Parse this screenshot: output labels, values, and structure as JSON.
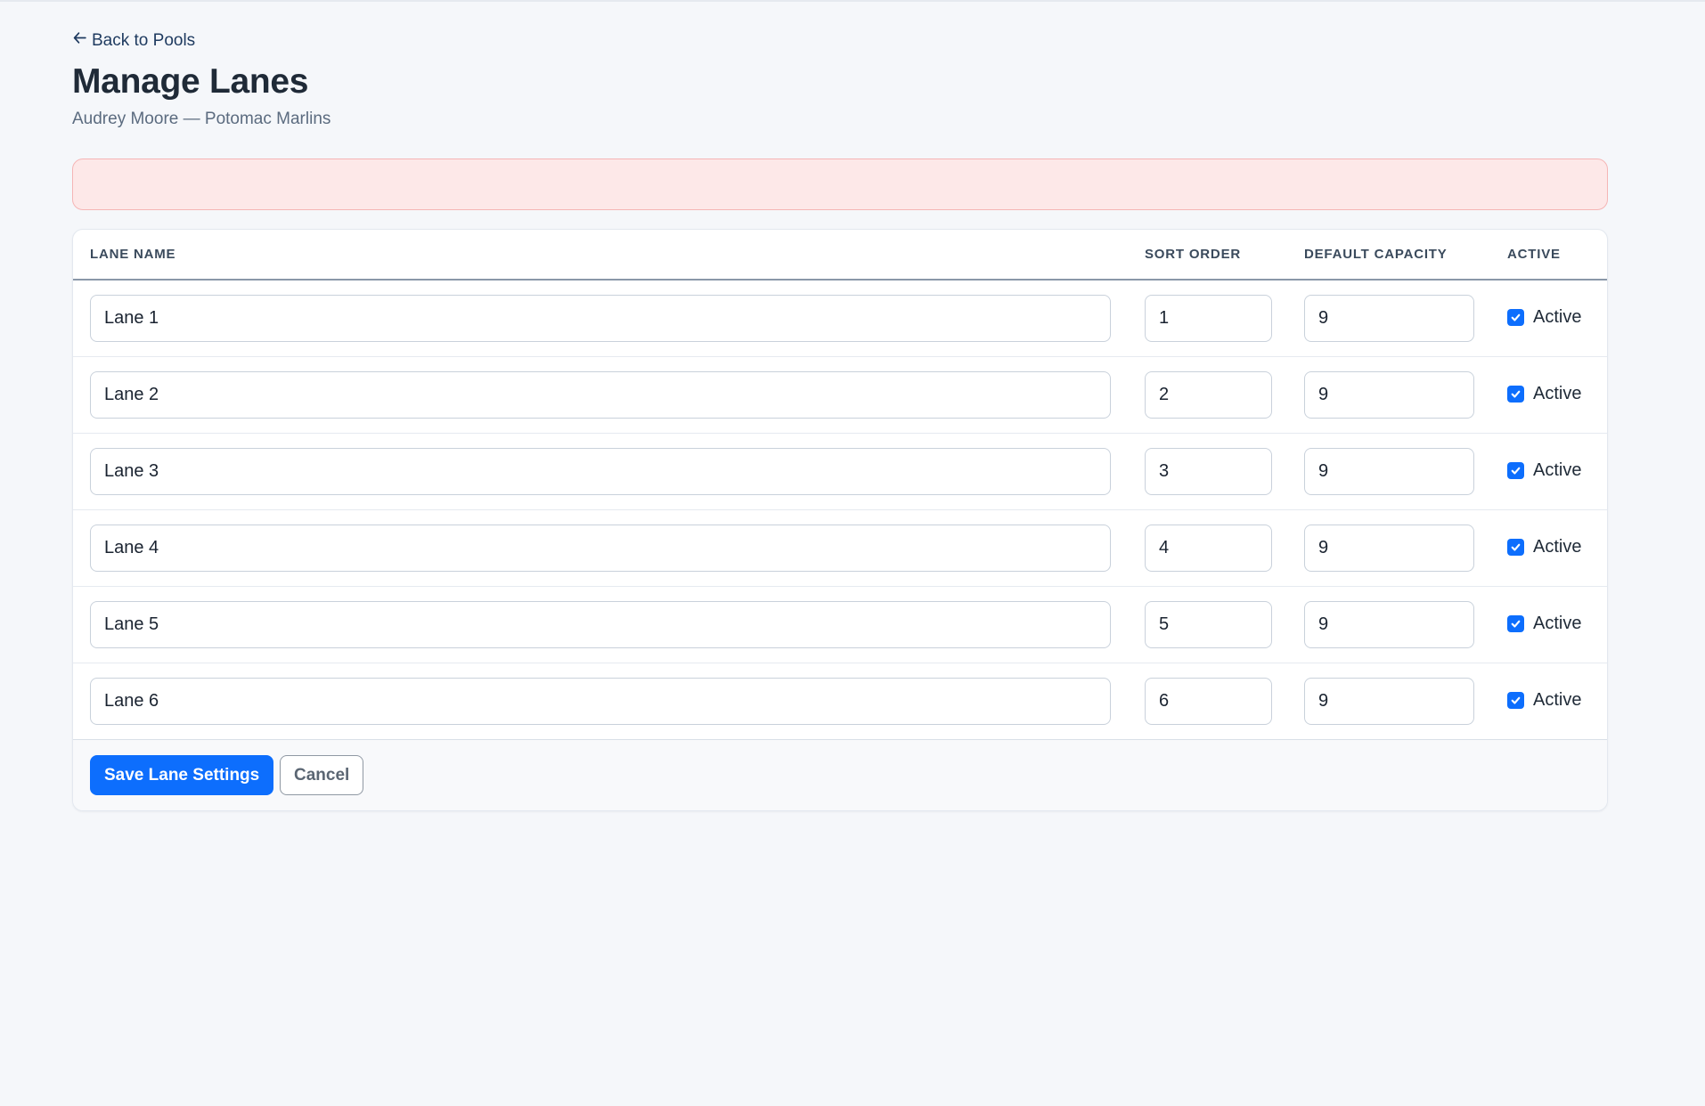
{
  "nav": {
    "back_label": "Back to Pools",
    "back_icon": "arrow-left-icon"
  },
  "header": {
    "title": "Manage Lanes",
    "subtitle": "Audrey Moore — Potomac Marlins"
  },
  "alert": {
    "message": "",
    "color": "#fde8e8"
  },
  "table": {
    "columns": [
      "LANE NAME",
      "SORT ORDER",
      "DEFAULT CAPACITY",
      "ACTIVE"
    ],
    "rows": [
      {
        "name": "Lane 1",
        "sort_order": "1",
        "capacity": "9",
        "active": true,
        "active_label": "Active"
      },
      {
        "name": "Lane 2",
        "sort_order": "2",
        "capacity": "9",
        "active": true,
        "active_label": "Active"
      },
      {
        "name": "Lane 3",
        "sort_order": "3",
        "capacity": "9",
        "active": true,
        "active_label": "Active"
      },
      {
        "name": "Lane 4",
        "sort_order": "4",
        "capacity": "9",
        "active": true,
        "active_label": "Active"
      },
      {
        "name": "Lane 5",
        "sort_order": "5",
        "capacity": "9",
        "active": true,
        "active_label": "Active"
      },
      {
        "name": "Lane 6",
        "sort_order": "6",
        "capacity": "9",
        "active": true,
        "active_label": "Active"
      }
    ]
  },
  "actions": {
    "save_label": "Save Lane Settings",
    "cancel_label": "Cancel"
  },
  "colors": {
    "accent": "#0d6efd",
    "background": "#f5f7fa",
    "alert_bg": "#fde8e8"
  }
}
